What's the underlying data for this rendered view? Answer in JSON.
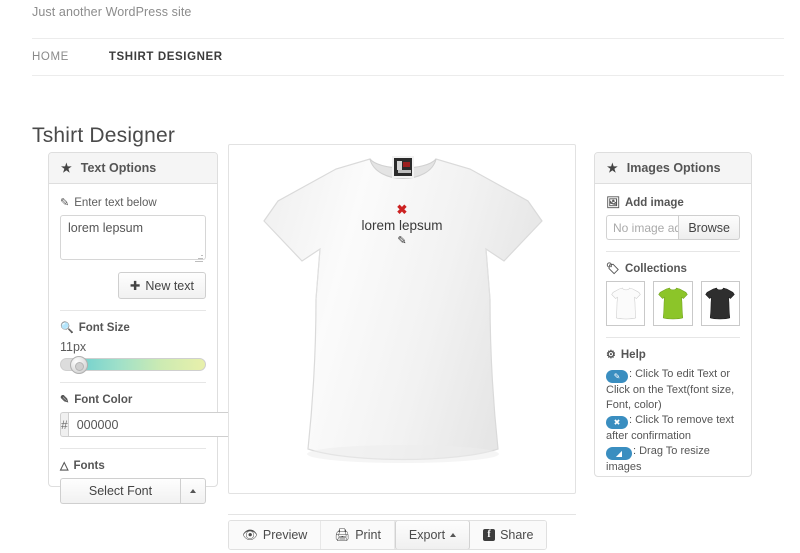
{
  "site": {
    "tagline": "Just another WordPress site",
    "nav": [
      {
        "label": "HOME",
        "active": false
      },
      {
        "label": "TSHIRT DESIGNER",
        "active": true
      }
    ]
  },
  "page": {
    "title": "Tshirt Designer"
  },
  "text_options": {
    "header": "Text Options",
    "header_icon": "star-icon",
    "enter_text_label": "Enter text below",
    "enter_text_icon": "pencil-square-icon",
    "textarea_value": "lorem lepsum",
    "textarea_placeholder": "",
    "new_text_button": "New text",
    "new_text_icon": "plus-icon",
    "font_size_label": "Font Size",
    "font_size_icon": "magnifier-icon",
    "font_size_value": "11px",
    "font_size_percent": 6,
    "font_color_label": "Font Color",
    "font_color_icon": "eyedropper-icon",
    "color_prefix": "#",
    "color_value": "000000",
    "color_swatch": "#000000",
    "fonts_label": "Fonts",
    "fonts_icon": "font-icon",
    "select_font_button": "Select Font",
    "select_font_caret": "caret-up-icon"
  },
  "stage": {
    "design_text": "lorem lepsum",
    "delete_icon": "x-remove-icon",
    "edit_icon": "pencil-square-icon",
    "shirt_color": "#f4f4f4",
    "neck_tag": "shirt-brand-label"
  },
  "toolbar": {
    "items": [
      {
        "label": "Preview",
        "icon": "eye-icon",
        "raised": false
      },
      {
        "label": "Print",
        "icon": "printer-icon",
        "raised": false
      },
      {
        "label": "Export",
        "icon": "caret-up-icon",
        "raised": true
      },
      {
        "label": "Share",
        "icon": "facebook-icon",
        "raised": false
      }
    ]
  },
  "images_options": {
    "header": "Images Options",
    "header_icon": "star-icon",
    "add_image_label": "Add image",
    "add_image_icon": "picture-icon",
    "file_placeholder": "No image added...",
    "browse_button": "Browse",
    "collections_label": "Collections",
    "collections_icon": "tag-icon",
    "collections": [
      {
        "name": "white-tshirt",
        "color": "#fcfcfc"
      },
      {
        "name": "green-tshirt",
        "color": "#8cc529"
      },
      {
        "name": "black-tshirt",
        "color": "#2e2e2e"
      }
    ],
    "help_label": "Help",
    "help_icon": "gear-icon",
    "help_items": [
      {
        "badge": "pencil-square-icon",
        "glyph": "✎",
        "text": ": Click To edit Text or Click on the Text(font size, Font, color)"
      },
      {
        "badge": "x-close-icon",
        "glyph": "✖",
        "text": ": Click To remove text after confirmation"
      },
      {
        "badge": "resize-handle-icon",
        "glyph": "◢",
        "text": ": Drag To resize images"
      }
    ]
  },
  "colors": {
    "accent_blue": "#3a8ec0",
    "delete_red": "#cc2222",
    "panel_border": "#dedede",
    "panel_head_bg": "#f5f5f5"
  }
}
